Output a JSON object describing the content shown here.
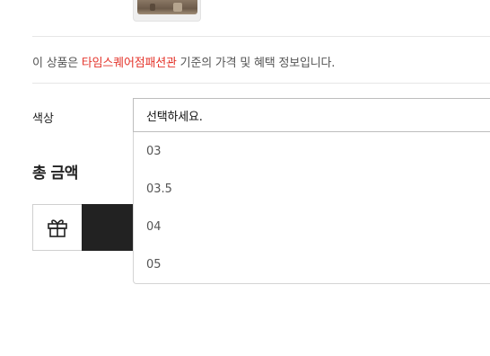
{
  "product": {
    "thumbnail_icon": "bag-thumbnail-image"
  },
  "notice": {
    "prefix": "이 상품은 ",
    "store": "타임스퀘어점패션관",
    "suffix": " 기준의 가격 및 혜택 정보입니다.",
    "store_color": "#e4342b"
  },
  "options": {
    "color_label": "색상",
    "select_placeholder": "선택하세요.",
    "items": [
      "03",
      "03.5",
      "04",
      "05"
    ]
  },
  "total": {
    "label": "총 금액"
  },
  "actions": {
    "gift_icon": "gift-icon",
    "buy_button_color": "#222222"
  }
}
